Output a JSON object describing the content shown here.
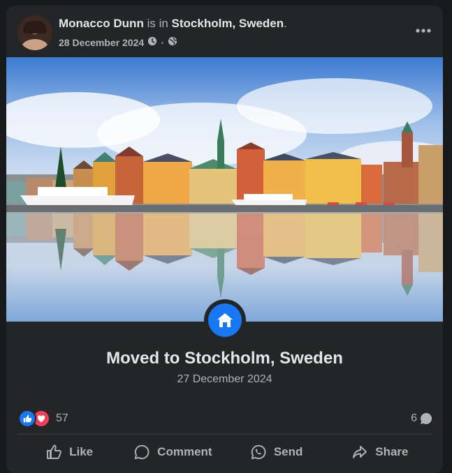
{
  "post": {
    "author": "Monacco Dunn",
    "status_connector": "is in",
    "location": "Stockholm, Sweden",
    "status_end": ".",
    "date": "28 December 2024",
    "meta_separator": "·"
  },
  "life_event": {
    "title": "Moved to Stockholm, Sweden",
    "date": "27 December 2024",
    "icon": "home-icon"
  },
  "reactions": {
    "types": [
      "like",
      "love"
    ],
    "count": "57"
  },
  "comments": {
    "count": "6"
  },
  "actions": {
    "like": "Like",
    "comment": "Comment",
    "send": "Send",
    "share": "Share"
  },
  "colors": {
    "accent": "#1877f2",
    "love": "#f33e58",
    "card_bg": "#242526",
    "text_primary": "#e4e6eb",
    "text_secondary": "#b0b3b8"
  }
}
